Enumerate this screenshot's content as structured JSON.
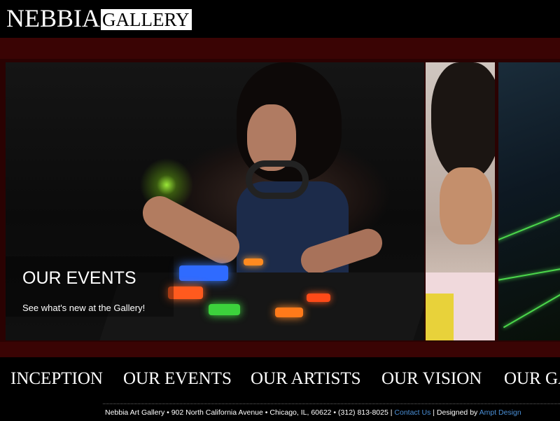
{
  "header": {
    "logo_part1": "NEBBIA",
    "logo_part2": "GALLERY"
  },
  "slider": {
    "caption_title": "OUR EVENTS",
    "caption_subtitle": "See what's new at the Gallery!"
  },
  "nav": {
    "items": [
      "INCEPTION",
      "OUR EVENTS",
      "OUR ARTISTS",
      "OUR VISION",
      "OUR GALLERY"
    ]
  },
  "footer": {
    "address": "Nebbia Art Gallery  •  902 North California Avenue  •  Chicago, IL, 60622  •  (312) 813-8025 |",
    "contact_link": "Contact Us",
    "designed_by_prefix": "| Designed by",
    "designer_link": "Ampt Design"
  },
  "colors": {
    "background": "#000000",
    "band": "#3a0404",
    "link": "#4a8fd6"
  }
}
